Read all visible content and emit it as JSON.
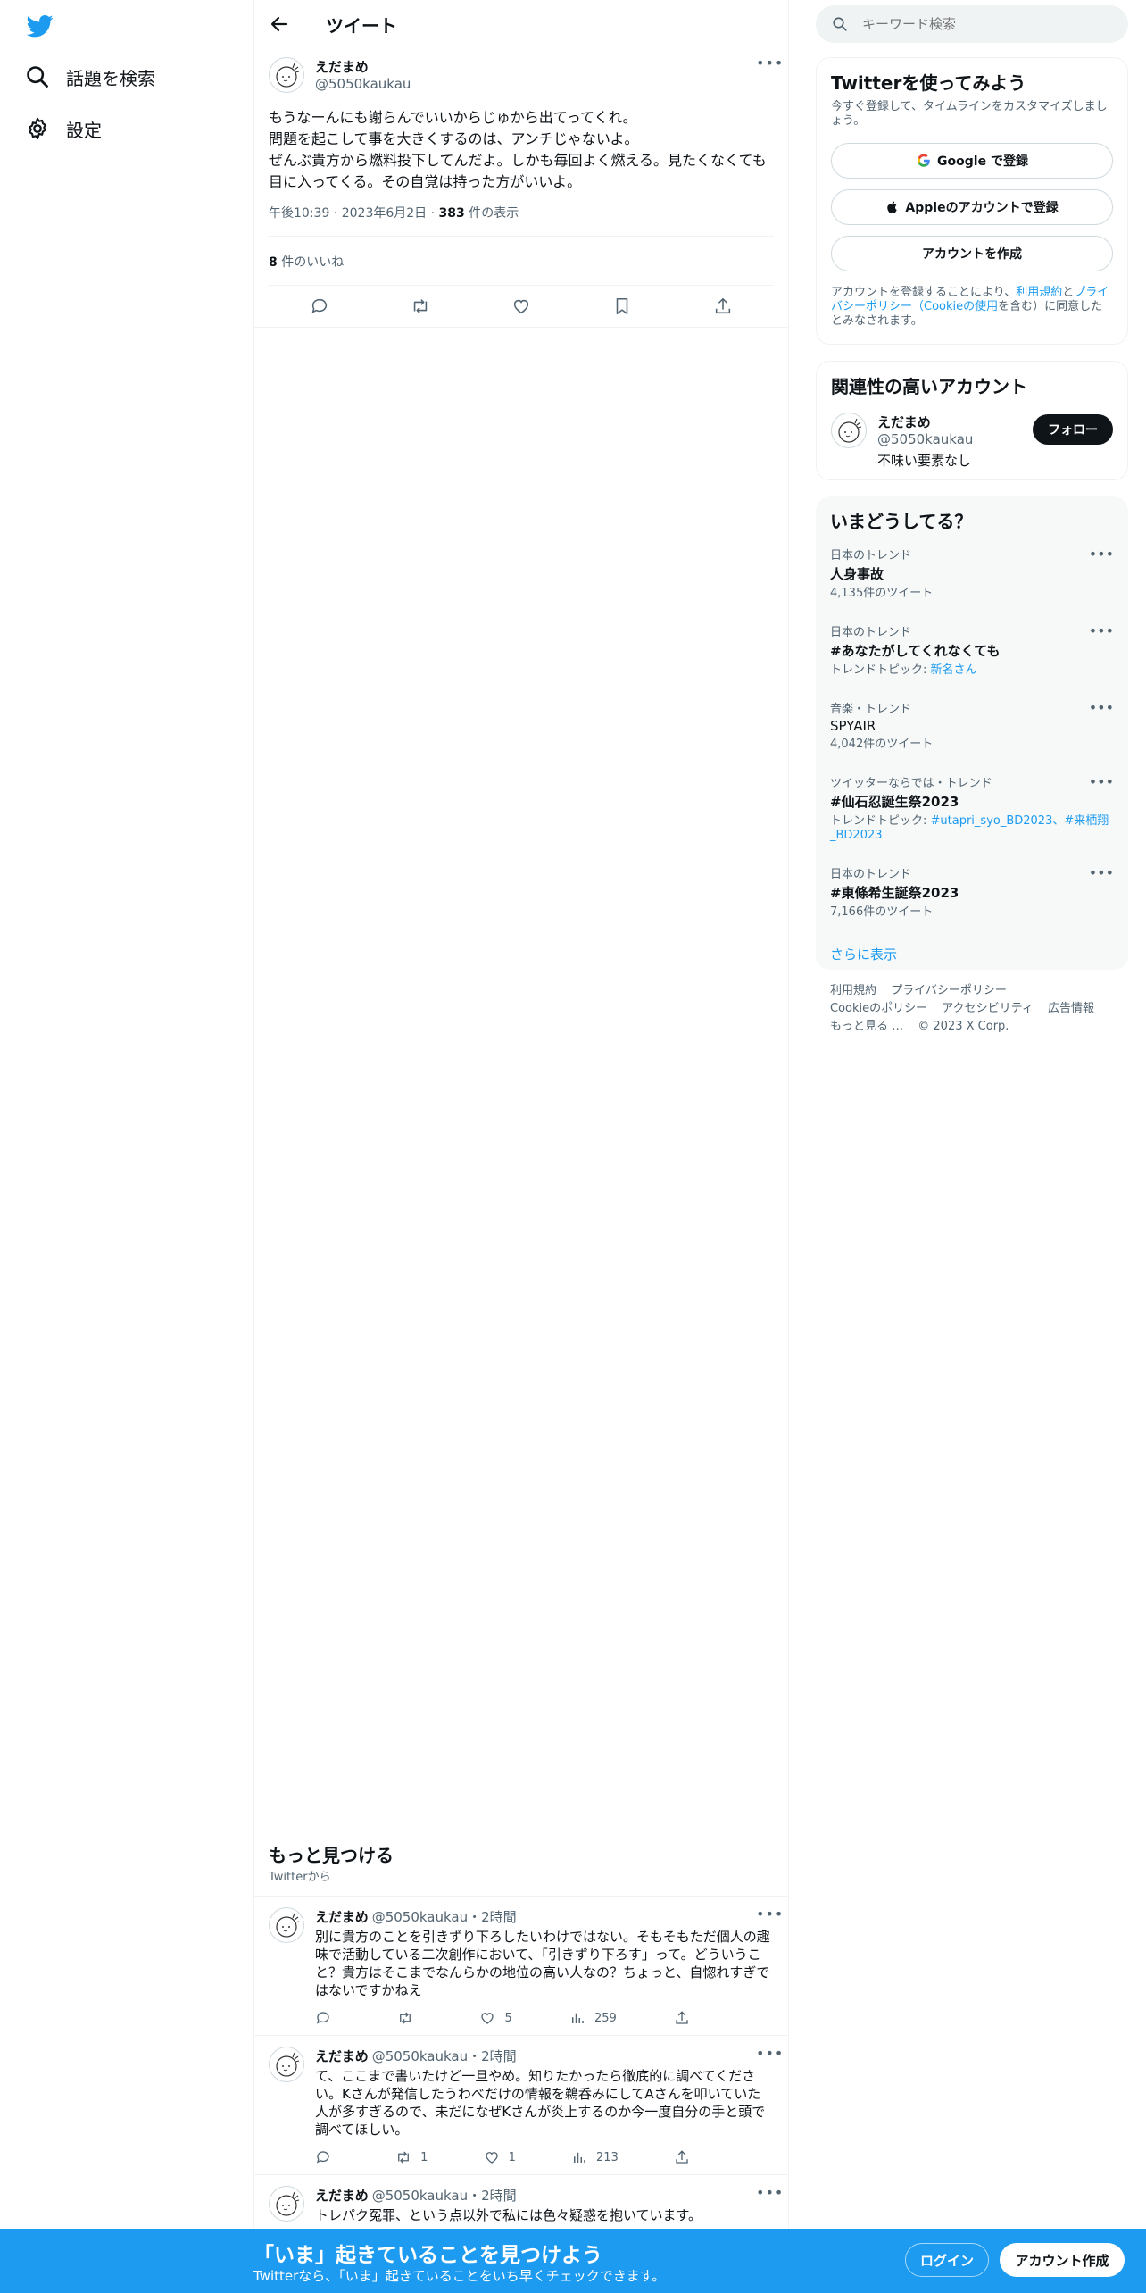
{
  "app": {
    "brand_color": "#1d9bf0"
  },
  "sidebar": {
    "logo_icon": "twitter-bird-icon",
    "items": [
      {
        "label": "話題を検索",
        "icon": "search-icon"
      },
      {
        "label": "設定",
        "icon": "gear-icon"
      }
    ]
  },
  "header": {
    "title": "ツイート",
    "back_icon": "back-arrow-icon"
  },
  "tweet": {
    "name": "えだまめ",
    "handle": "@5050kaukau",
    "body": "もうなーんにも謝らんでいいからじゅから出てってくれ。\n問題を起こして事を大きくするのは、アンチじゃないよ。\nぜんぶ貴方から燃料投下してんだよ。しかも毎回よく燃える。見たくなくても目に入ってくる。その自覚は持った方がいいよ。",
    "time": "午後10:39",
    "date": "2023年6月2日",
    "views_count": "383",
    "views_label": " 件の表示",
    "likes_count": "8",
    "likes_label": " 件のいいね"
  },
  "discover": {
    "title": "もっと見つける",
    "subtitle": "Twitterから",
    "items": [
      {
        "name": "えだまめ",
        "handle": "@5050kaukau",
        "time": "・2時間",
        "text": "別に貴方のことを引きずり下ろしたいわけではない。そもそもただ個人の趣味で活動している二次創作において、「引きずり下ろす」って。どういうこと？貴方はそこまでなんらかの地位の高い人なの？ちょっと、自惚れすぎではないですかねえ",
        "replies": "",
        "retweets": "",
        "likes": "5",
        "views": "259"
      },
      {
        "name": "えだまめ",
        "handle": "@5050kaukau",
        "time": "・2時間",
        "text": "て、ここまで書いたけど一旦やめ。知りたかったら徹底的に調べてください。Kさんが発信したうわべだけの情報を鵜呑みにしてAさんを叩いていた人が多すぎるので、未だになぜKさんが炎上するのか今一度自分の手と頭で調べてほしい。",
        "replies": "",
        "retweets": "1",
        "likes": "1",
        "views": "213"
      },
      {
        "name": "えだまめ",
        "handle": "@5050kaukau",
        "time": "・2時間",
        "text": "トレパク冤罪、という点以外で私には色々疑惑を抱いています。",
        "replies": "",
        "retweets": "",
        "likes": "",
        "views": ""
      }
    ]
  },
  "search": {
    "placeholder": "キーワード検索"
  },
  "signup": {
    "title": "Twitterを使ってみよう",
    "subtitle": "今すぐ登録して、タイムラインをカスタマイズしましょう。",
    "google_label": "Google で登録",
    "apple_label": "Appleのアカウントで登録",
    "create_label": "アカウントを作成",
    "terms_prefix": "アカウントを登録することにより、",
    "terms_link": "利用規約",
    "terms_and": "と",
    "privacy_link": "プライバシーポリシー（Cookieの使用",
    "terms_suffix": "を含む）に同意したとみなされます。"
  },
  "related": {
    "title": "関連性の高いアカウント",
    "name": "えだまめ",
    "handle": "@5050kaukau",
    "bio": "不味い要素なし",
    "follow_label": "フォロー"
  },
  "trends": {
    "title": "いまどうしてる？",
    "items": [
      {
        "category": "日本のトレンド",
        "name": "人身事故",
        "sub_prefix": "4,135件のツイート",
        "sub_link": ""
      },
      {
        "category": "日本のトレンド",
        "name": "#あなたがしてくれなくても",
        "sub_prefix": "トレンドトピック: ",
        "sub_link": "新名さん"
      },
      {
        "category": "音楽・トレンド",
        "name": "SPYAIR",
        "sub_prefix": "4,042件のツイート",
        "sub_link": ""
      },
      {
        "category": "ツイッターならでは・トレンド",
        "name": "#仙石忍誕生祭2023",
        "sub_prefix": "トレンドトピック: ",
        "sub_link": "#utapri_syo_BD2023、#来栖翔_BD2023"
      },
      {
        "category": "日本のトレンド",
        "name": "#東條希生誕祭2023",
        "sub_prefix": "7,166件のツイート",
        "sub_link": ""
      }
    ],
    "show_more": "さらに表示"
  },
  "footer": {
    "links": [
      "利用規約",
      "プライバシーポリシー",
      "Cookieのポリシー",
      "アクセシビリティ",
      "広告情報",
      "もっと見る …",
      "© 2023 X Corp."
    ]
  },
  "bottom_bar": {
    "title": "「いま」起きていることを見つけよう",
    "subtitle": "Twitterなら、「いま」起きていることをいち早くチェックできます。",
    "login_label": "ログイン",
    "signup_label": "アカウント作成"
  }
}
